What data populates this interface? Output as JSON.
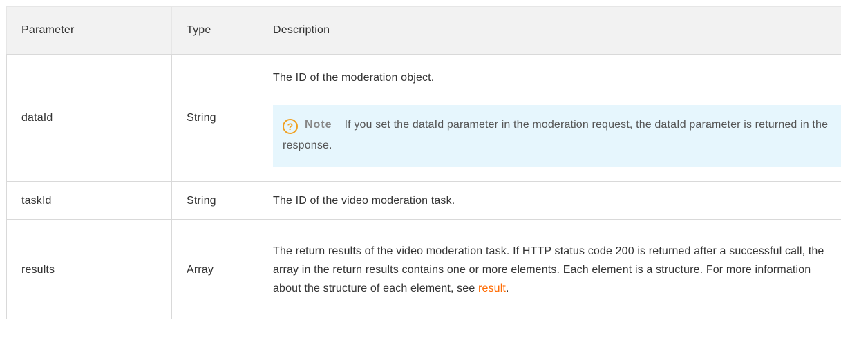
{
  "table": {
    "headers": {
      "parameter": "Parameter",
      "type": "Type",
      "description": "Description"
    },
    "rows": [
      {
        "parameter": "dataId",
        "type": "String",
        "description": "The ID of the moderation object.",
        "note": {
          "icon": "question-circle-icon",
          "title": "Note",
          "text": "If you set the dataId parameter in the moderation request, the dataId parameter is returned in the response."
        }
      },
      {
        "parameter": "taskId",
        "type": "String",
        "description": "The ID of the video moderation task."
      },
      {
        "parameter": "results",
        "type": "Array",
        "description_before_link": "The return results of the video moderation task. If HTTP status code 200 is returned after a successful call, the array in the return results contains one or more elements. Each element is a structure. For more information about the structure of each element, see ",
        "link_text": "result",
        "description_after_link": "."
      }
    ]
  },
  "colors": {
    "link": "#ff6a00",
    "note_background": "#e6f6fd",
    "note_icon": "#f0a020",
    "header_background": "#f2f2f2"
  }
}
